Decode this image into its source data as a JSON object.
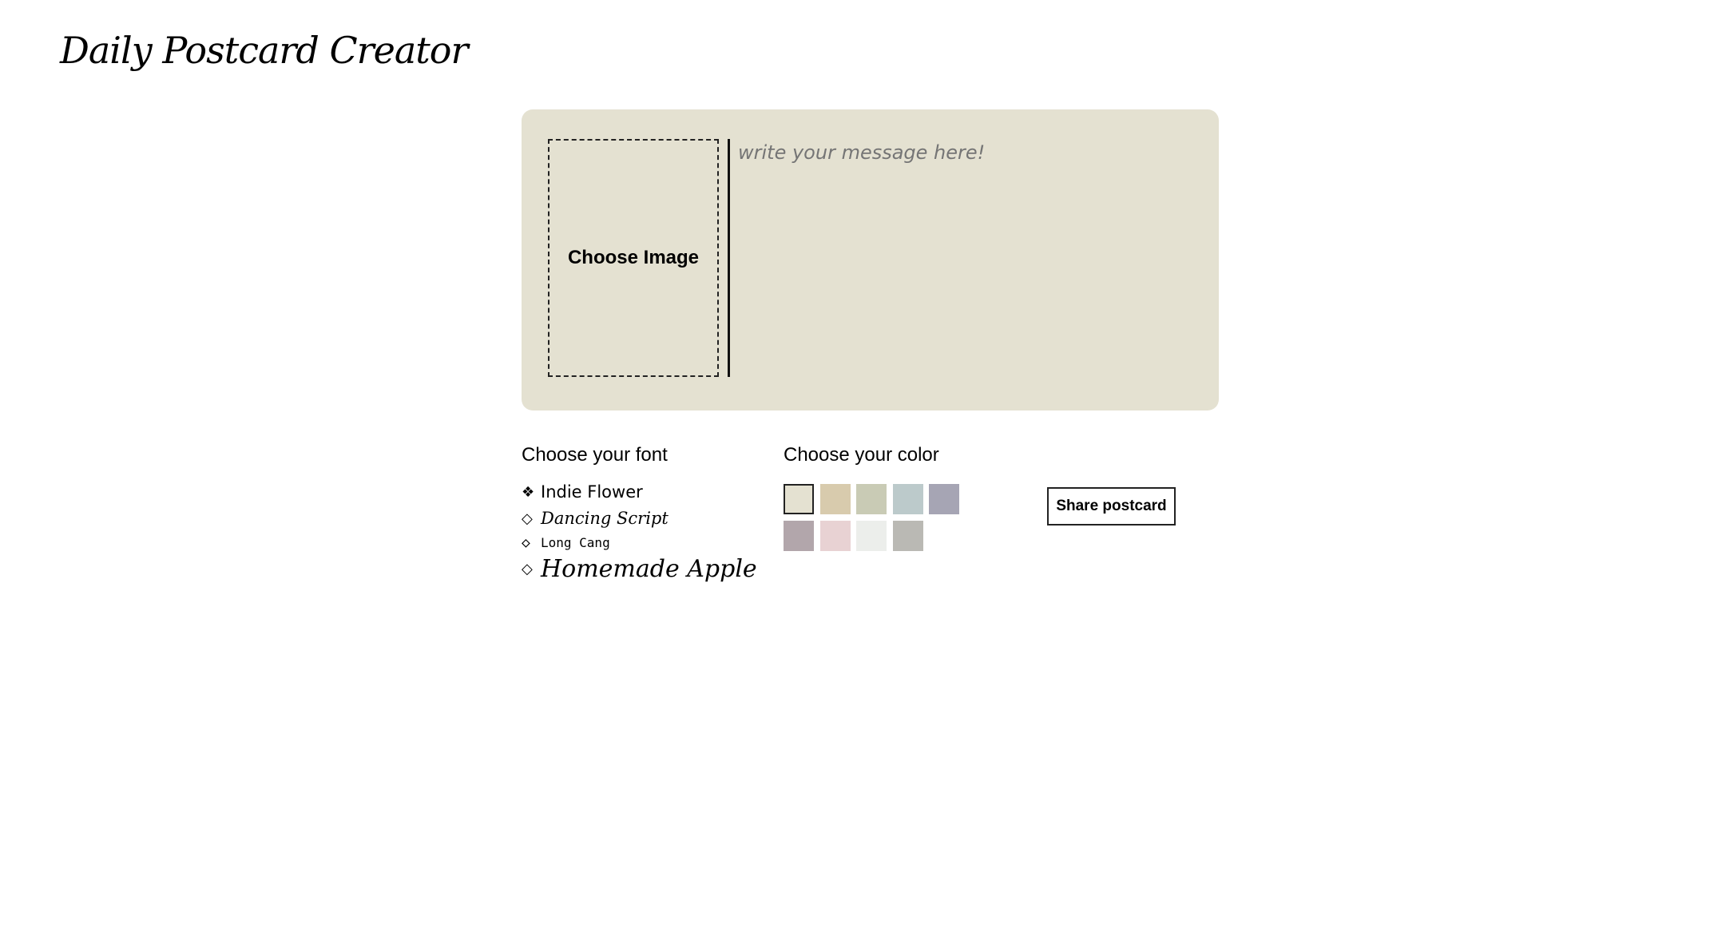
{
  "header": {
    "title": "Daily Postcard Creator"
  },
  "postcard": {
    "choose_image_label": "Choose Image",
    "message_placeholder": "write your message here!",
    "background": "#e4e1d1"
  },
  "font_picker": {
    "heading": "Choose your font",
    "options": [
      {
        "label": "Indie Flower",
        "marker": "❖",
        "selected": true
      },
      {
        "label": "Dancing Script",
        "marker": "◇",
        "selected": false
      },
      {
        "label": "Long Cang",
        "marker": "◇",
        "selected": false
      },
      {
        "label": "Homemade Apple",
        "marker": "◇",
        "selected": false
      }
    ]
  },
  "color_picker": {
    "heading": "Choose your color",
    "colors": [
      "#e4e1d1",
      "#d8cbad",
      "#c9cbb5",
      "#bccacb",
      "#a6a5b4",
      "#b2a6ab",
      "#e8d2d3",
      "#eceeeb",
      "#bab9b4"
    ],
    "selected_index": 0
  },
  "actions": {
    "share_label": "Share postcard"
  }
}
